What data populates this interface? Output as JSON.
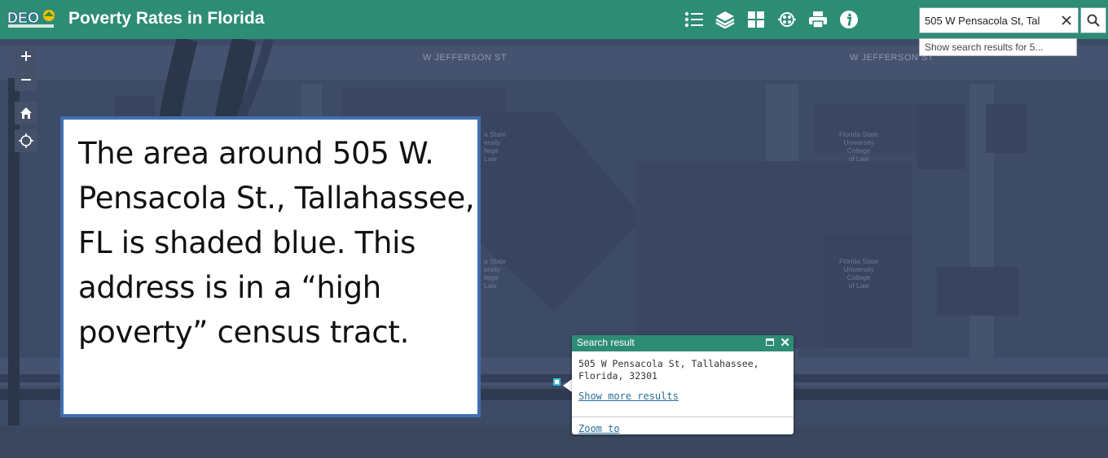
{
  "header": {
    "logo_text": "DEO",
    "title": "Poverty Rates in Florida",
    "tools": [
      {
        "name": "legend-icon"
      },
      {
        "name": "layers-icon"
      },
      {
        "name": "basemap-gallery-icon"
      },
      {
        "name": "analysis-icon"
      },
      {
        "name": "print-icon"
      },
      {
        "name": "info-icon"
      }
    ]
  },
  "search": {
    "value": "505 W Pensacola St, Tal",
    "suggestion": "Show search results for 5..."
  },
  "map": {
    "streets": {
      "jefferson_left": "W JEFFERSON ST",
      "jefferson_right": "W JEFFERSON ST"
    },
    "building_labels": [
      "Florida State\nUniversity\nCollege\nof Law",
      "Florida State\nUniversity\nCollege\nof Law",
      "a State\nersity\nllege\nLaw",
      "a State\nersity\nllege\nLaw"
    ]
  },
  "callout": {
    "text": "The area around 505 W. Pensacola St., Tallahassee, FL is shaded blue. This address is in a “high poverty” census tract."
  },
  "popup": {
    "title": "Search result",
    "address": "505 W Pensacola St, Tallahassee, Florida, 32301",
    "more_link": "Show more results",
    "zoom_link": "Zoom to"
  },
  "colors": {
    "header": "#2d8c74",
    "map_fill": "#3e4b66",
    "callout_border": "#3f6fb0",
    "marker": "#37c2d8"
  }
}
